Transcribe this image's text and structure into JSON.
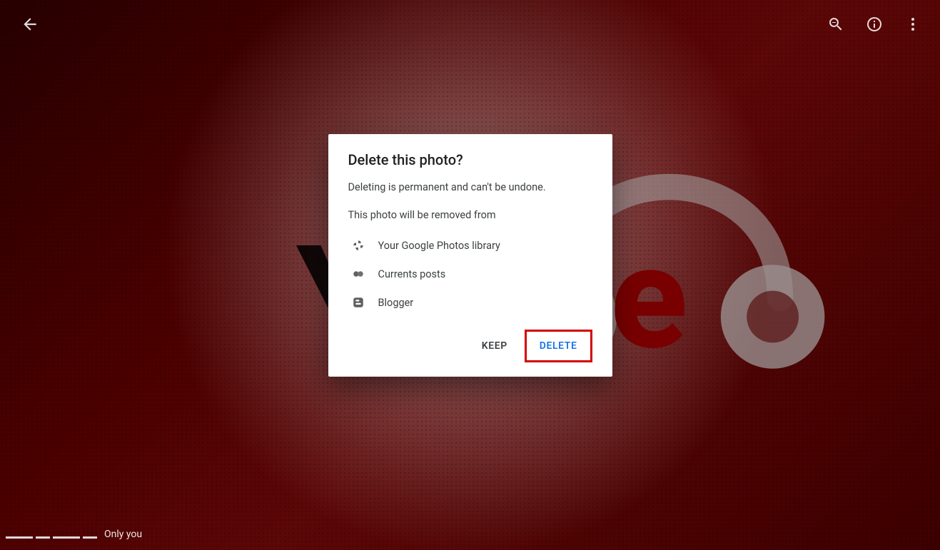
{
  "toolbar": {
    "back_label": "Back",
    "zoom_label": "Zoom",
    "info_label": "Info",
    "more_label": "More options"
  },
  "dialog": {
    "title": "Delete this photo?",
    "warning": "Deleting is permanent and can't be undone.",
    "removed_from_intro": "This photo will be removed from",
    "destinations": [
      {
        "icon": "google-photos-icon",
        "label": "Your Google Photos library"
      },
      {
        "icon": "currents-icon",
        "label": "Currents posts"
      },
      {
        "icon": "blogger-icon",
        "label": "Blogger"
      }
    ],
    "keep_label": "Keep",
    "delete_label": "Delete"
  },
  "footer": {
    "visibility": "Only you"
  },
  "colors": {
    "accent_blue": "#1a73e8",
    "highlight_red": "#d40000"
  }
}
